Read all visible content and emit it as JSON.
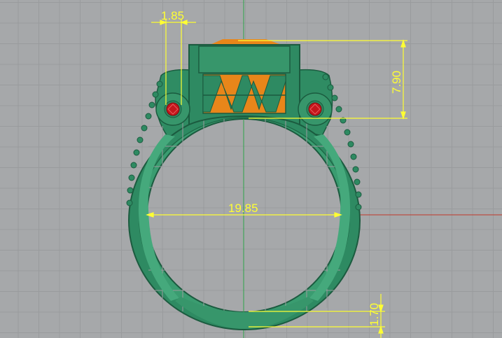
{
  "viewport": {
    "background": "#a6a8aa",
    "grid_color": "#999b9d",
    "y_axis_color": "#2fa44a",
    "x_axis_color": "#c0392b"
  },
  "model": {
    "band_color": "#2e8a62",
    "band_highlight": "#3fa77a",
    "gem_color": "#e8861a",
    "side_stone_color": "#c4161c"
  },
  "dimensions": {
    "stone_width": "1.85",
    "head_height": "7.90",
    "inner_diameter": "19.85",
    "shank_thickness": "1.70",
    "color": "#ffff33"
  }
}
